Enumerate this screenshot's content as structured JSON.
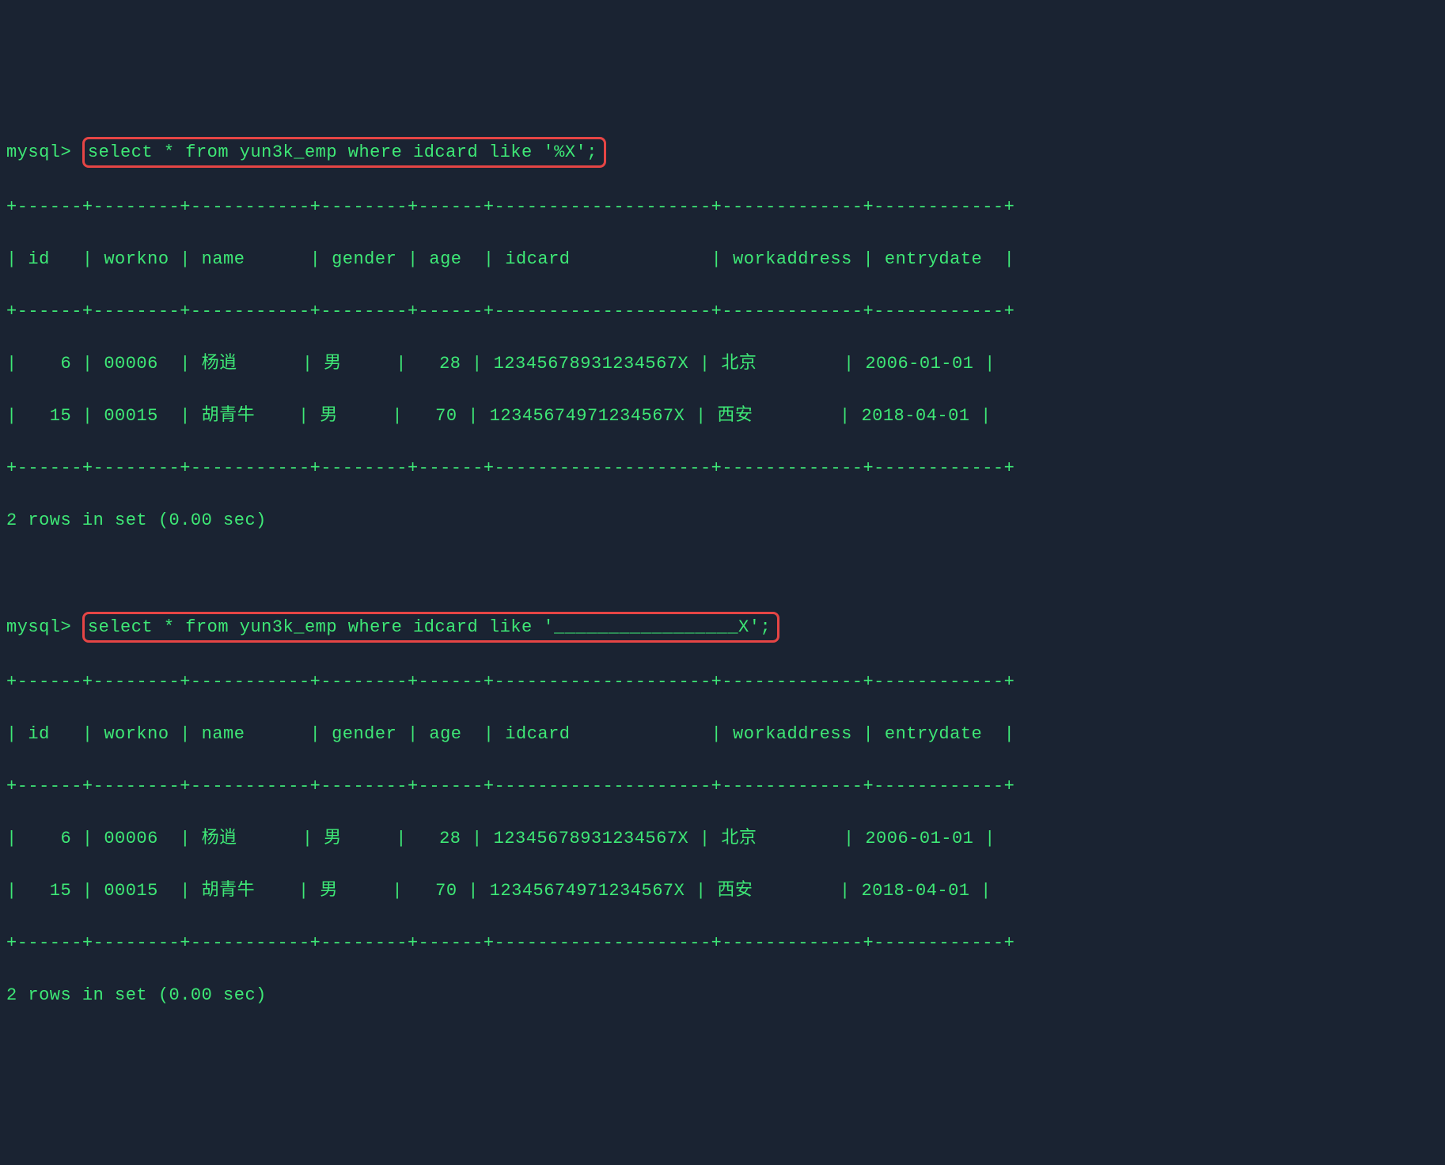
{
  "prompt": "mysql> ",
  "query1": {
    "sql": "select * from yun3k_emp where idcard like '%X';",
    "result_rows": "2 rows in set (0.00 sec)"
  },
  "query2": {
    "sql": "select * from yun3k_emp where idcard like '_________________X';",
    "result_rows": "2 rows in set (0.00 sec)"
  },
  "table": {
    "border_top": "+------+--------+-----------+--------+------+--------------------+-------------+------------+",
    "header_row": "| id   | workno | name      | gender | age  | idcard             | workaddress | entrydate  |",
    "border_mid": "+------+--------+-----------+--------+------+--------------------+-------------+------------+",
    "data_1": "|    6 | 00006  | 杨逍      | 男     |   28 | 12345678931234567X | 北京        | 2006-01-01 |",
    "data_2": "|   15 | 00015  | 胡青牛    | 男     |   70 | 12345674971234567X | 西安        | 2018-04-01 |",
    "border_bottom": "+------+--------+-----------+--------+------+--------------------+-------------+------------+"
  },
  "chart_data": {
    "type": "table",
    "columns": [
      "id",
      "workno",
      "name",
      "gender",
      "age",
      "idcard",
      "workaddress",
      "entrydate"
    ],
    "rows": [
      {
        "id": 6,
        "workno": "00006",
        "name": "杨逍",
        "gender": "男",
        "age": 28,
        "idcard": "12345678931234567X",
        "workaddress": "北京",
        "entrydate": "2006-01-01"
      },
      {
        "id": 15,
        "workno": "00015",
        "name": "胡青牛",
        "gender": "男",
        "age": 70,
        "idcard": "12345674971234567X",
        "workaddress": "西安",
        "entrydate": "2018-04-01"
      }
    ]
  }
}
